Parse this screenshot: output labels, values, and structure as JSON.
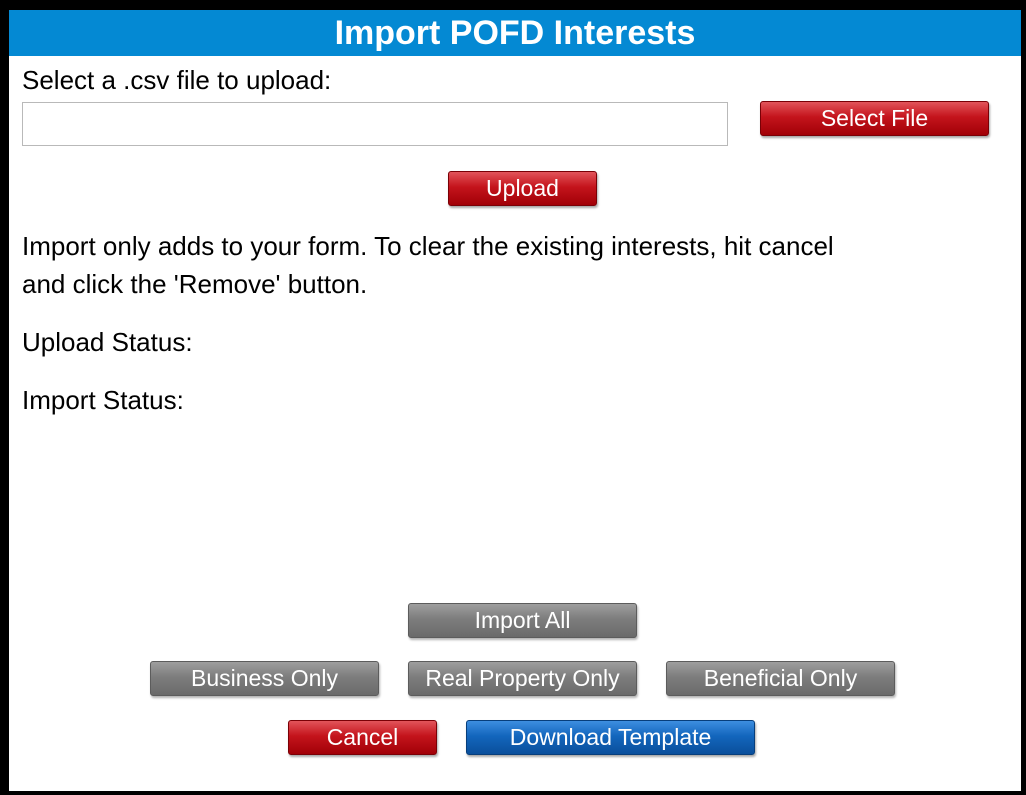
{
  "dialog": {
    "title": "Import POFD Interests",
    "select_prompt": "Select a .csv file to upload:",
    "file_field_value": "",
    "select_file_label": "Select File",
    "upload_label": "Upload",
    "info_line1": "Import only adds to your form. To clear the existing interests, hit cancel",
    "info_line2": "and click the 'Remove' button.",
    "upload_status_label": "Upload Status:",
    "import_status_label": "Import Status:"
  },
  "actions": {
    "import_all": "Import All",
    "business_only": "Business Only",
    "real_property_only": "Real Property Only",
    "beneficial_only": "Beneficial Only",
    "cancel": "Cancel",
    "download_template": "Download Template"
  },
  "colors": {
    "title_bar": "#0489d3",
    "primary_red": "#c4141c",
    "disabled_gray": "#7d7d7d",
    "download_blue": "#1366bd"
  }
}
